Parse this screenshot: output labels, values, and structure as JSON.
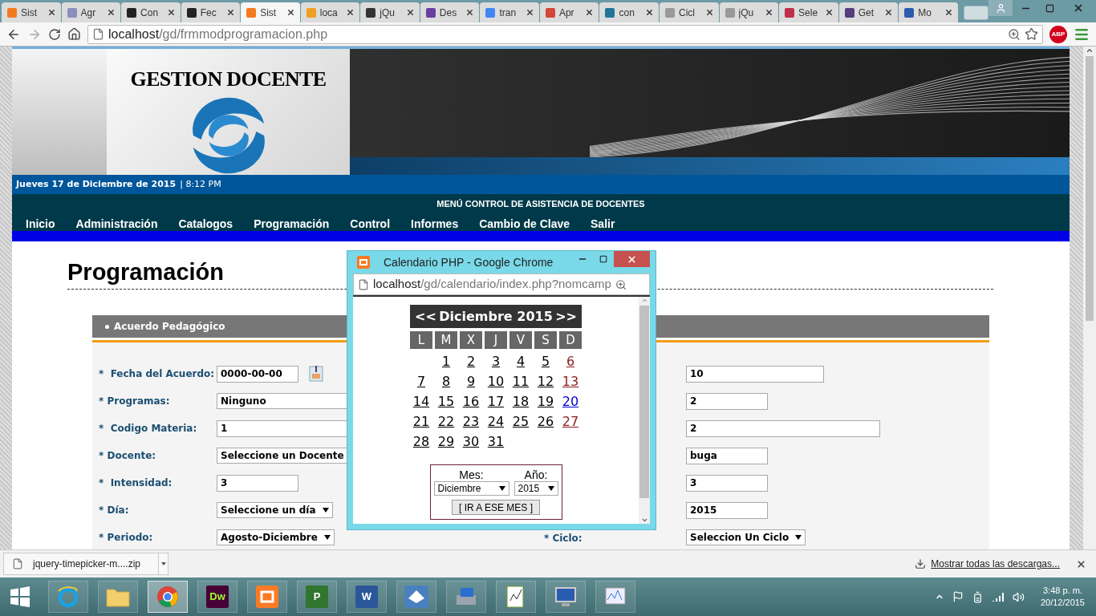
{
  "browser": {
    "tabs": [
      {
        "title": "Sist",
        "color": "#f47a20",
        "selected": false
      },
      {
        "title": "Agr",
        "color": "#8a8fc0",
        "selected": false
      },
      {
        "title": "Con",
        "color": "#222222",
        "selected": false
      },
      {
        "title": "Fec",
        "color": "#222222",
        "selected": false
      },
      {
        "title": "Sist",
        "color": "#f47a20",
        "selected": true
      },
      {
        "title": "loca",
        "color": "#f0a020",
        "selected": false
      },
      {
        "title": "jQu",
        "color": "#333333",
        "selected": false
      },
      {
        "title": "Des",
        "color": "#6a3fa0",
        "selected": false
      },
      {
        "title": "tran",
        "color": "#4285f4",
        "selected": false
      },
      {
        "title": "Apr",
        "color": "#d44638",
        "selected": false
      },
      {
        "title": "con",
        "color": "#21759b",
        "selected": false
      },
      {
        "title": "Cicl",
        "color": "#999999",
        "selected": false
      },
      {
        "title": "jQu",
        "color": "#999999",
        "selected": false
      },
      {
        "title": "Sele",
        "color": "#c0304a",
        "selected": false
      },
      {
        "title": "Get",
        "color": "#563d7c",
        "selected": false
      },
      {
        "title": "Mo",
        "color": "#2a5db0",
        "selected": false
      }
    ],
    "url_host": "localhost",
    "url_path": "/gd/frmmodprogramacion.php",
    "adblock": "ABP"
  },
  "page": {
    "banner_title": "GESTION DOCENTE",
    "date": "Jueves 17 de Diciembre de 2015",
    "time": "| 8:12 PM",
    "menu_title": "MENÚ CONTROL DE ASISTENCIA DE DOCENTES",
    "menu": [
      "Inicio",
      "Administración",
      "Catalogos",
      "Programación",
      "Control",
      "Informes",
      "Cambio de Clave",
      "Salir"
    ],
    "heading": "Programación",
    "section": "Acuerdo Pedagógico",
    "left_fields": [
      {
        "label": "*  Fecha del Acuerdo:",
        "kind": "short",
        "value": "0000-00-00",
        "calendar": true
      },
      {
        "label": "* Programas:",
        "kind": "select-wide",
        "value": "Ninguno"
      },
      {
        "label": "*  Codigo Materia:",
        "kind": "long",
        "value": "1"
      },
      {
        "label": "* Docente:",
        "kind": "select",
        "value": "Seleccione un Docente"
      },
      {
        "label": "*  Intensidad:",
        "kind": "short",
        "value": "3"
      },
      {
        "label": "* Día:",
        "kind": "select",
        "value": "Seleccione un día"
      },
      {
        "label": "* Periodo:",
        "kind": "select",
        "value": "Agosto-Diciembre"
      }
    ],
    "right_fields": [
      {
        "kind": "medium",
        "value": "10"
      },
      {
        "kind": "short",
        "value": "2"
      },
      {
        "kind": "long",
        "value": "2"
      },
      {
        "kind": "short",
        "value": "buga"
      },
      {
        "kind": "short",
        "value": "3"
      },
      {
        "kind": "short",
        "value": "2015"
      },
      {
        "label": "* Ciclo:",
        "kind": "select",
        "value": "Seleccion Un Ciclo"
      }
    ]
  },
  "popup": {
    "title": "Calendario PHP - Google Chrome",
    "url_host": "localhost",
    "url_path": "/gd/calendario/index.php?nomcamp",
    "prev": "<<",
    "month": "Diciembre 2015",
    "next": ">>",
    "weekdays": [
      "L",
      "M",
      "X",
      "J",
      "V",
      "S",
      "D"
    ],
    "weeks": [
      [
        {
          "day": "1",
          "kind": "weekday"
        },
        {
          "day": "2",
          "kind": "weekday"
        },
        {
          "day": "3",
          "kind": "weekday"
        },
        {
          "day": "4",
          "kind": "weekday"
        },
        {
          "day": "5",
          "kind": "weekday"
        },
        {
          "day": "6",
          "kind": "sunday"
        }
      ],
      [
        {
          "day": "7",
          "kind": "weekday"
        },
        {
          "day": "8",
          "kind": "weekday"
        },
        {
          "day": "9",
          "kind": "weekday"
        },
        {
          "day": "10",
          "kind": "weekday"
        },
        {
          "day": "11",
          "kind": "weekday"
        },
        {
          "day": "12",
          "kind": "weekday"
        },
        {
          "day": "13",
          "kind": "sunday"
        }
      ],
      [
        {
          "day": "14",
          "kind": "weekday"
        },
        {
          "day": "15",
          "kind": "weekday"
        },
        {
          "day": "16",
          "kind": "weekday"
        },
        {
          "day": "17",
          "kind": "weekday"
        },
        {
          "day": "18",
          "kind": "weekday"
        },
        {
          "day": "19",
          "kind": "weekday"
        },
        {
          "day": "20",
          "kind": "today"
        }
      ],
      [
        {
          "day": "21",
          "kind": "weekday"
        },
        {
          "day": "22",
          "kind": "weekday"
        },
        {
          "day": "23",
          "kind": "weekday"
        },
        {
          "day": "24",
          "kind": "weekday"
        },
        {
          "day": "25",
          "kind": "weekday"
        },
        {
          "day": "26",
          "kind": "weekday"
        },
        {
          "day": "27",
          "kind": "sunday"
        }
      ],
      [
        {
          "day": "28",
          "kind": "weekday"
        },
        {
          "day": "29",
          "kind": "weekday"
        },
        {
          "day": "30",
          "kind": "weekday"
        },
        {
          "day": "31",
          "kind": "weekday"
        }
      ]
    ],
    "month_label": "Mes:",
    "year_label": "Año:",
    "month_value": "Diciembre",
    "year_value": "2015",
    "go_button": "[ IR A ESE MES ]"
  },
  "downloads": {
    "file": "jquery-timepicker-m....zip",
    "show_all": "Mostrar todas las descargas..."
  },
  "taskbar": {
    "apps": [
      {
        "kind": "ie",
        "selected": false
      },
      {
        "kind": "folder",
        "selected": false
      },
      {
        "kind": "chrome",
        "selected": true
      },
      {
        "kind": "dw",
        "label": "Dw",
        "selected": false
      },
      {
        "kind": "xampp",
        "selected": false
      },
      {
        "kind": "project",
        "label": "P",
        "selected": false
      },
      {
        "kind": "word",
        "label": "W",
        "selected": false
      },
      {
        "kind": "ship",
        "selected": false
      },
      {
        "kind": "printer",
        "selected": false
      },
      {
        "kind": "editor",
        "selected": false
      },
      {
        "kind": "monitor",
        "selected": false
      },
      {
        "kind": "chart",
        "selected": false
      }
    ],
    "time": "3:48 p. m.",
    "date": "20/12/2015"
  }
}
